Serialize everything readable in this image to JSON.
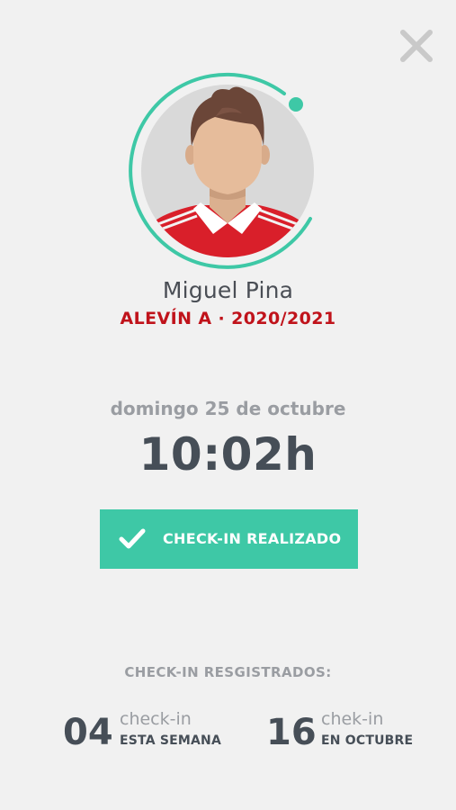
{
  "header": {
    "close_icon": "close-icon"
  },
  "profile": {
    "name": "Miguel Pina",
    "team": "ALEVÍN A · 2020/2021",
    "avatar_icon": "player-avatar",
    "accent_color": "#3ec8a6",
    "team_color": "#c0131b"
  },
  "checkin": {
    "date": "domingo 25 de octubre",
    "time": "10:02h",
    "button_label": "CHECK-IN REALIZADO",
    "button_icon": "checkmark-icon",
    "button_color": "#3ec8a6"
  },
  "stats": {
    "title": "CHECK-IN RESGISTRADOS:",
    "week": {
      "count": "04",
      "unit": "check-in",
      "period": "ESTA SEMANA"
    },
    "month": {
      "count": "16",
      "unit": "chek-in",
      "period": "EN OCTUBRE"
    }
  }
}
